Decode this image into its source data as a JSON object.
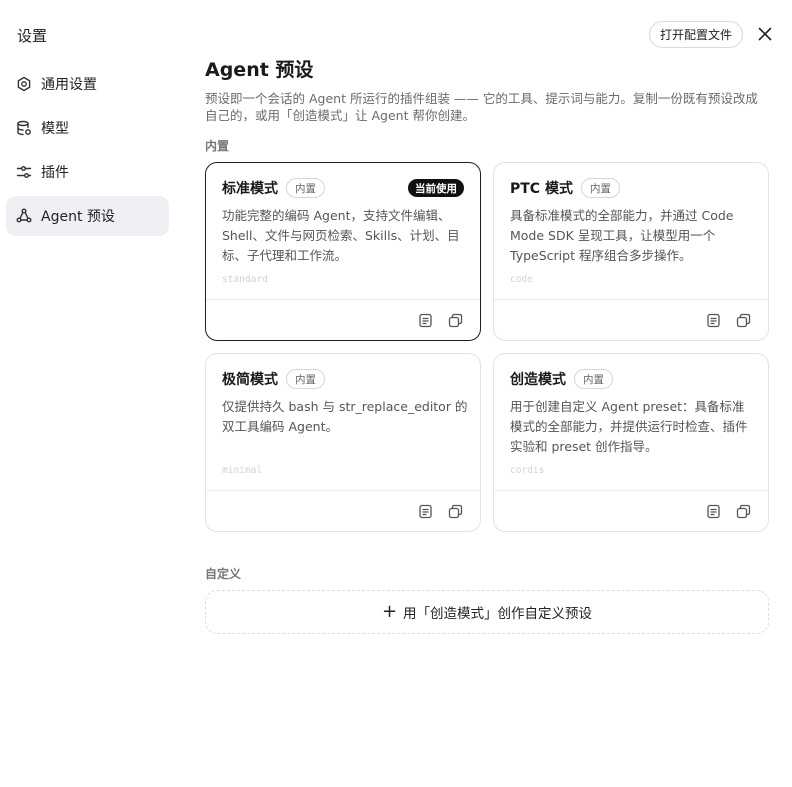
{
  "sidebar": {
    "title": "设置",
    "items": [
      {
        "label": "通用设置",
        "icon": "gear-icon"
      },
      {
        "label": "模型",
        "icon": "database-icon"
      },
      {
        "label": "插件",
        "icon": "sliders-icon"
      },
      {
        "label": "Agent 预设",
        "icon": "nodes-icon",
        "active": true
      }
    ]
  },
  "header": {
    "open_config_label": "打开配置文件",
    "close_icon": "close-icon"
  },
  "main": {
    "title": "Agent 预设",
    "description": "预设即一个会话的 Agent 所运行的插件组装 —— 它的工具、提示词与能力。复制一份既有预设改成自己的，或用「创造模式」让 Agent 帮你创建。",
    "builtin_section_label": "内置",
    "custom_section_label": "自定义",
    "builtin_badge": "内置",
    "current_badge": "当前使用",
    "presets": [
      {
        "title": "标准模式",
        "desc": "功能完整的编码 Agent，支持文件编辑、Shell、文件与网页检索、Skills、计划、目标、子代理和工作流。",
        "id": "standard",
        "current": true
      },
      {
        "title": "PTC 模式",
        "desc": "具备标准模式的全部能力，并通过 Code Mode SDK 呈现工具，让模型用一个 TypeScript 程序组合多步操作。",
        "id": "code",
        "current": false
      },
      {
        "title": "极简模式",
        "desc": "仅提供持久 bash 与 str_replace_editor 的双工具编码 Agent。",
        "id": "minimal",
        "current": false
      },
      {
        "title": "创造模式",
        "desc": "用于创建自定义 Agent preset：具备标准模式的全部能力，并提供运行时检查、插件实验和 preset 创作指导。",
        "id": "cordis",
        "current": false
      }
    ],
    "add_custom_label": "用「创造模式」创作自定义预设",
    "action_icons": [
      "document-icon",
      "copy-icon"
    ]
  }
}
